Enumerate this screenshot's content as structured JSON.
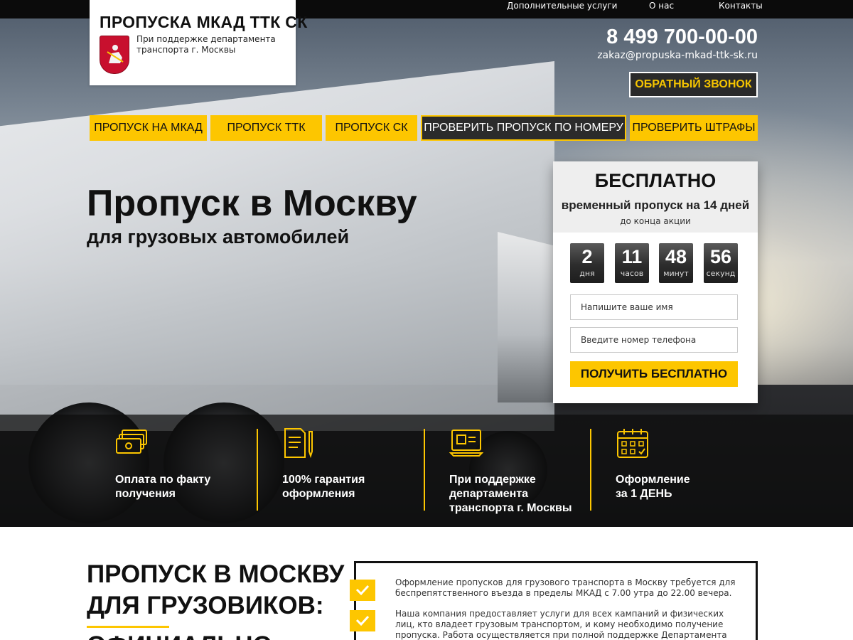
{
  "topnav": {
    "items": [
      "Дополнительные услуги",
      "О нас",
      "Контакты"
    ]
  },
  "logo": {
    "title": "ПРОПУСКА МКАД ТТК СК",
    "subtitle": "При поддержке департамента транспорта г. Москвы",
    "emblem_icon": "moscow-coat-of-arms-icon"
  },
  "contacts": {
    "phone": "8 499 700-00-00",
    "email": "zakaz@propuska-mkad-ttk-sk.ru",
    "callback_label": "ОБРАТНЫЙ ЗВОНОК"
  },
  "mainnav": {
    "items": [
      "ПРОПУСК НА МКАД",
      "ПРОПУСК ТТК",
      "ПРОПУСК СК",
      "ПРОВЕРИТЬ ПРОПУСК ПО НОМЕРУ",
      "ПРОВЕРИТЬ ШТРАФЫ"
    ]
  },
  "hero": {
    "title": "Пропуск в Москву",
    "subtitle": "для грузовых автомобилей"
  },
  "promo": {
    "headline": "БЕСПЛАТНО",
    "line": "временный пропуск на 14 дней",
    "small": "до конца акции",
    "timer": [
      {
        "value": "2",
        "unit": "дня"
      },
      {
        "value": "11",
        "unit": "часов"
      },
      {
        "value": "48",
        "unit": "минут"
      },
      {
        "value": "56",
        "unit": "секунд"
      }
    ],
    "name_placeholder": "Напишите ваше имя",
    "phone_placeholder": "Введите номер телефона",
    "submit_label": "ПОЛУЧИТЬ БЕСПЛАТНО"
  },
  "advantages": [
    {
      "icon": "money-icon",
      "line1": "Оплата по факту",
      "line2": "получения",
      "line3": ""
    },
    {
      "icon": "document-pen-icon",
      "line1": "100% гарантия",
      "line2": "оформления",
      "line3": ""
    },
    {
      "icon": "monitor-id-icon",
      "line1": "При поддержке",
      "line2": "департамента",
      "line3": "транспорта г. Москвы"
    },
    {
      "icon": "calendar-icon",
      "line1": "Оформление",
      "line2": "за 1 ДЕНЬ",
      "line3": ""
    }
  ],
  "section": {
    "title_line1": "ПРОПУСК В МОСКВУ",
    "title_line2": "ДЛЯ ГРУЗОВИКОВ:",
    "title_line3": "ОФИЦИАЛЬНО",
    "paragraphs": [
      "Оформление пропусков для грузового транспорта в Москву требуется для беспрепятственного въезда в пределы МКАД с 7.00 утра до 22.00 вечера.",
      "Наша компания предоставляет услуги для всех кампаний и физических лиц, кто владеет грузовым транспортом, и кому необходимо получение пропуска. Работа осуществляется при полной поддержке Департамента транспорта"
    ]
  },
  "colors": {
    "accent": "#fdc600",
    "dark": "#2b2b2b",
    "emblem": "#c8102e"
  }
}
